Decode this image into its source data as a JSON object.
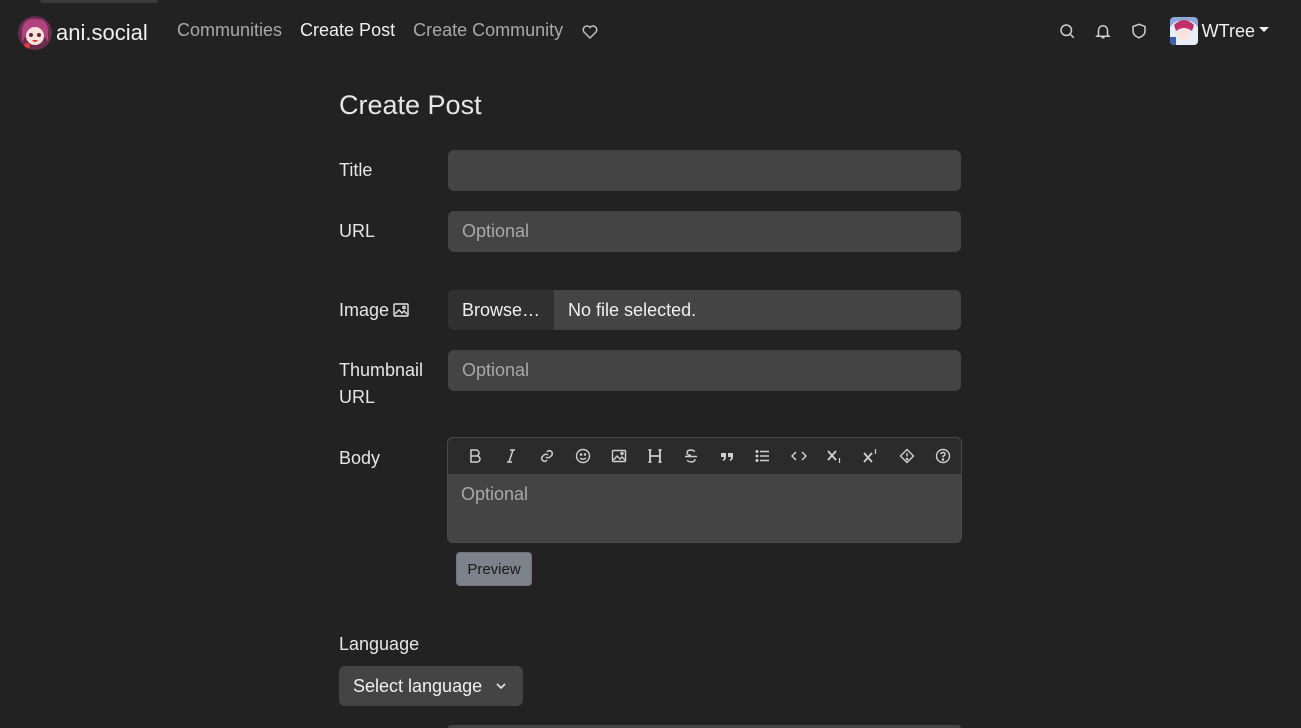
{
  "header": {
    "site_name": "ani.social",
    "nav": [
      {
        "label": "Communities"
      },
      {
        "label": "Create Post"
      },
      {
        "label": "Create Community"
      }
    ],
    "user": {
      "name": "WTree"
    }
  },
  "form": {
    "title": "Create Post",
    "fields": {
      "title": {
        "label": "Title",
        "placeholder": "",
        "value": ""
      },
      "url": {
        "label": "URL",
        "placeholder": "Optional"
      },
      "image": {
        "label": "Image",
        "browse_label": "Browse…",
        "status": "No file selected."
      },
      "thumbnail": {
        "label_line1": "Thumbnail",
        "label_line2": "URL",
        "placeholder": "Optional"
      },
      "body": {
        "label": "Body",
        "placeholder": "Optional"
      }
    },
    "preview_label": "Preview",
    "language": {
      "label": "Language",
      "selected": "Select language"
    }
  },
  "editor_toolbar": [
    {
      "icon": "bold-icon"
    },
    {
      "icon": "italic-icon"
    },
    {
      "icon": "link-icon"
    },
    {
      "icon": "emoji-icon"
    },
    {
      "icon": "image-icon"
    },
    {
      "icon": "header-icon"
    },
    {
      "icon": "strikethrough-icon"
    },
    {
      "icon": "quote-icon"
    },
    {
      "icon": "list-icon"
    },
    {
      "icon": "code-icon"
    },
    {
      "icon": "subscript-icon"
    },
    {
      "icon": "superscript-icon"
    },
    {
      "icon": "spoiler-icon"
    },
    {
      "icon": "help-icon"
    }
  ],
  "colors": {
    "background": "#222222",
    "input_bg": "#444444",
    "toolbar_bg": "#2b2b2b",
    "preview_button": "#7c828a"
  }
}
